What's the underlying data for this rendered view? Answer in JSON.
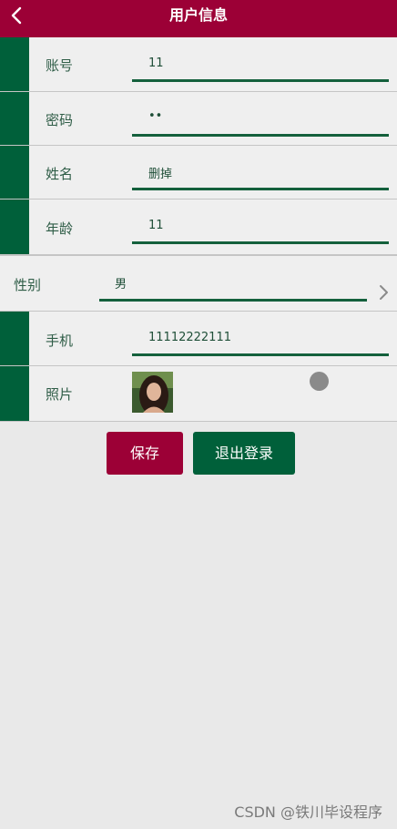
{
  "header": {
    "title": "用户信息",
    "back_icon": "chevron-left-icon"
  },
  "form": {
    "account": {
      "label": "账号",
      "value": "11"
    },
    "password": {
      "label": "密码",
      "value": "••"
    },
    "name": {
      "label": "姓名",
      "value": "删掉"
    },
    "age": {
      "label": "年龄",
      "value": "11"
    },
    "gender": {
      "label": "性别",
      "value": "男",
      "icon": "chevron-right-icon"
    },
    "phone": {
      "label": "手机",
      "value": "11112222111"
    },
    "photo": {
      "label": "照片"
    }
  },
  "actions": {
    "save_label": "保存",
    "logout_label": "退出登录"
  },
  "watermark": "CSDN @铁川毕设程序",
  "colors": {
    "header": "#9c0036",
    "accent": "#00603a",
    "background": "#e9e9e9"
  }
}
